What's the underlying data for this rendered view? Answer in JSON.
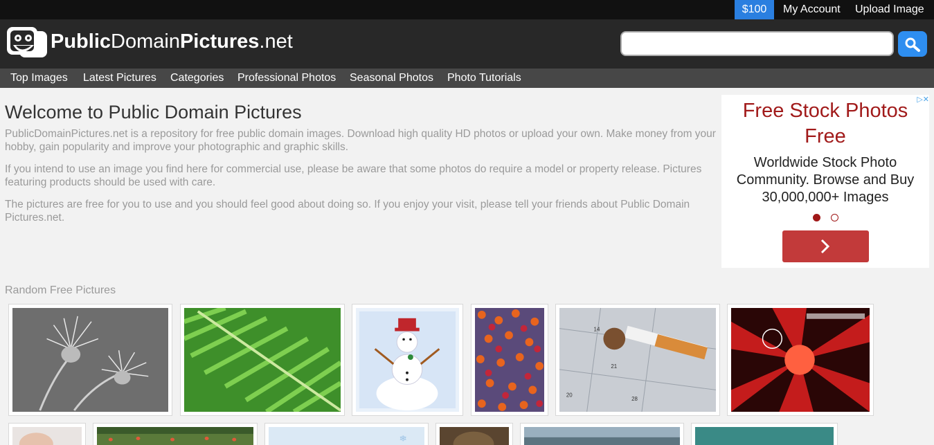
{
  "topbar": {
    "credit": "$100",
    "my_account": "My Account",
    "upload_image": "Upload Image"
  },
  "header": {
    "logo_bold_1": "Public",
    "logo_regular_1": "Domain",
    "logo_bold_2": "Pictures",
    "logo_regular_2": ".net",
    "search_value": ""
  },
  "nav": {
    "items": [
      "Top Images",
      "Latest Pictures",
      "Categories",
      "Professional Photos",
      "Seasonal Photos",
      "Photo Tutorials"
    ]
  },
  "welcome": {
    "title": "Welcome to Public Domain Pictures",
    "paragraphs": [
      "PublicDomainPictures.net is a repository for free public domain images. Download high quality HD photos or upload your own. Make money from your hobby, gain popularity and improve your photographic and graphic skills.",
      "If you intend to use an image you find here for commercial use, please be aware that some photos do require a model or property release. Pictures featuring products should be used with care.",
      "The pictures are free for you to use and you should feel good about doing so. If you enjoy your visit, please tell your friends about Public Domain Pictures.net."
    ]
  },
  "ad": {
    "marks": "▷✕",
    "title": "Free Stock Photos Free",
    "body": "Worldwide Stock Photo Community. Browse and Buy 30,000,000+ Images"
  },
  "random": {
    "label": "Random Free Pictures",
    "thumbnail_subjects": [
      "thistle",
      "fern",
      "snowman",
      "tulips",
      "cigarette",
      "abstract-red",
      "baby",
      "park",
      "snowflakes",
      "owl",
      "sea",
      "water"
    ]
  },
  "colors": {
    "topbar": "#111111",
    "header": "#282828",
    "nav": "#474747",
    "credit": "#2a7fe0",
    "ad_title": "#a11a1a",
    "ad_button": "#c23a3a"
  }
}
